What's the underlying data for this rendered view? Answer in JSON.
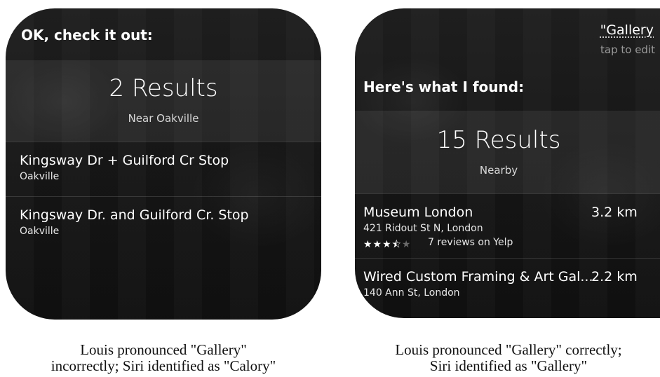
{
  "left_panel": {
    "heading": "OK, check it out:",
    "results_title": "2 Results",
    "results_subtitle": "Near Oakville",
    "results": [
      {
        "name": "Kingsway Dr + Guilford Cr Stop",
        "location": "Oakville"
      },
      {
        "name": "Kingsway Dr. and Guilford Cr. Stop",
        "location": "Oakville"
      }
    ]
  },
  "right_panel": {
    "query_text": "\"Gallery",
    "tap_to_edit": "tap to edit",
    "heading": "Here's what I found:",
    "results_title": "15 Results",
    "results_subtitle": "Nearby",
    "results": [
      {
        "name": "Museum London",
        "address": "421 Ridout St N, London",
        "distance": "3.2 km",
        "rating_stars": 3.5,
        "reviews": "7 reviews on Yelp"
      },
      {
        "name": "Wired Custom Framing & Art Gal...",
        "address": "140 Ann St, London",
        "distance": "2.2 km"
      }
    ]
  },
  "captions": {
    "left_line1": "Louis pronounced \"Gallery\"",
    "left_line2": "incorrectly; Siri identified as \"Calory\"",
    "right_line1": "Louis pronounced \"Gallery\" correctly;",
    "right_line2": "Siri identified as \"Gallery\""
  }
}
